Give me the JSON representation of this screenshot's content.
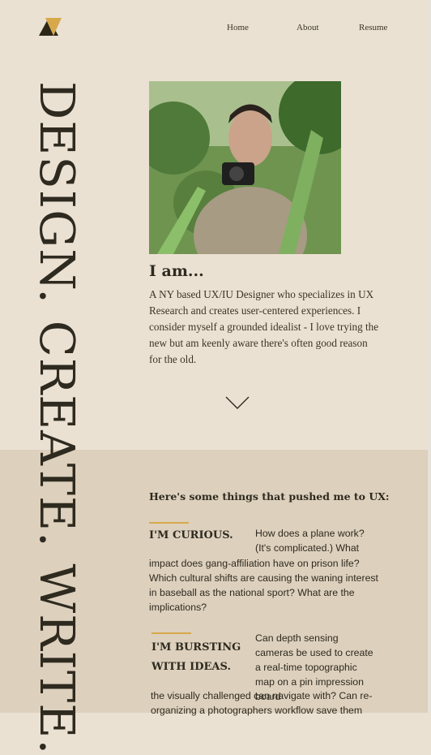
{
  "nav": {
    "home": "Home",
    "about": "About",
    "resume": "Resume"
  },
  "hero": {
    "vertical_text": "DESIGN. CREATE. WRITE.",
    "intro_heading": "I am...",
    "intro_text": "A NY based UX/IU Designer who specializes in UX Research and creates user-centered experiences. I consider myself a grounded idealist - I love trying the new but am keenly aware there's often good reason for the old."
  },
  "section": {
    "title": "Here's some things that pushed me to UX:",
    "items": [
      {
        "heading": "I'M CURIOUS.",
        "text_a": "How does a plane work? (It's complicated.) What",
        "text_b": "impact does gang-affiliation have on prison life? Which cultural shifts are causing the waning interest in baseball as the national sport? What are the implications?"
      },
      {
        "heading": "I'M BURSTING WITH IDEAS.",
        "text_a": "Can depth sensing cameras be used to create a real-time topographic map on a pin impression board",
        "text_b": "the visually challenged can navigate with? Can re-organizing a photographers workflow save them"
      }
    ]
  },
  "colors": {
    "background": "#ebe1d3",
    "band": "#ddd0bd",
    "accent": "#d7a94b",
    "text": "#2e2a1f"
  },
  "icons": {
    "logo": "triangle-logo-icon",
    "scroll": "chevron-down-icon"
  }
}
